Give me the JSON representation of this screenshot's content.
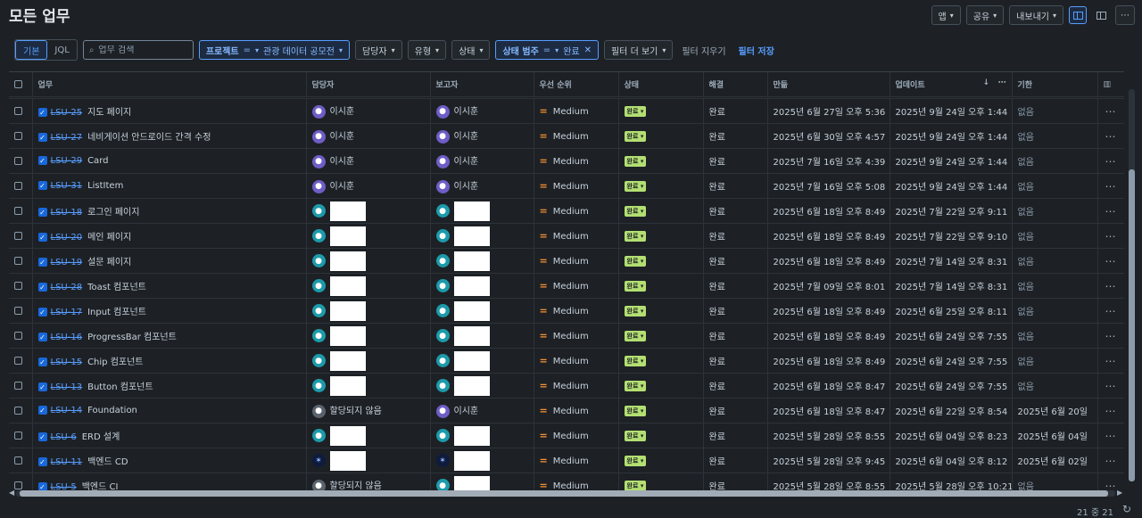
{
  "page": {
    "title": "모든 업무"
  },
  "toolbar": {
    "app": "앱",
    "share": "공유",
    "export": "내보내기",
    "more": "⋯"
  },
  "view_toggle": {
    "basic": "기본",
    "jql": "JQL"
  },
  "search": {
    "placeholder": "업무 검색",
    "value": ""
  },
  "filters": {
    "project_label": "프로젝트",
    "project_op": "=",
    "project_value": "관광 데이터 공모전",
    "assignee": "담당자",
    "type": "유형",
    "status": "상태",
    "category_label": "상태 범주",
    "category_op": "=",
    "category_value": "완료",
    "more_filters": "필터 더 보기",
    "clear": "필터 지우기",
    "save": "필터 저장"
  },
  "columns": [
    "업무",
    "담당자",
    "보고자",
    "우선 순위",
    "상태",
    "해결",
    "만듦",
    "업데이트",
    "기한"
  ],
  "rows": [
    {
      "key": "LSU-25",
      "summary": "지도 페이지",
      "assignee": "이시훈",
      "assignee_avatar": "purple",
      "reporter": "이시훈",
      "reporter_avatar": "purple",
      "priority": "Medium",
      "status": "완료",
      "resolution": "완료",
      "created": "2025년 6월 27일 오후 5:36",
      "updated": "2025년 9월 24일 오후 1:44",
      "due": "없음"
    },
    {
      "key": "LSU-27",
      "summary": "네비게이션 안드로이드 간격 수정",
      "assignee": "이시훈",
      "assignee_avatar": "purple",
      "reporter": "이시훈",
      "reporter_avatar": "purple",
      "priority": "Medium",
      "status": "완료",
      "resolution": "완료",
      "created": "2025년 6월 30일 오후 4:57",
      "updated": "2025년 9월 24일 오후 1:44",
      "due": "없음"
    },
    {
      "key": "LSU-29",
      "summary": "Card",
      "assignee": "이시훈",
      "assignee_avatar": "purple",
      "reporter": "이시훈",
      "reporter_avatar": "purple",
      "priority": "Medium",
      "status": "완료",
      "resolution": "완료",
      "created": "2025년 7월 16일 오후 4:39",
      "updated": "2025년 9월 24일 오후 1:44",
      "due": "없음"
    },
    {
      "key": "LSU-31",
      "summary": "ListItem",
      "assignee": "이시훈",
      "assignee_avatar": "purple",
      "reporter": "이시훈",
      "reporter_avatar": "purple",
      "priority": "Medium",
      "status": "완료",
      "resolution": "완료",
      "created": "2025년 7월 16일 오후 5:08",
      "updated": "2025년 9월 24일 오후 1:44",
      "due": "없음"
    },
    {
      "key": "LSU-18",
      "summary": "로그인 페이지",
      "assignee": "",
      "assignee_avatar": "cyan",
      "reporter": "",
      "reporter_avatar": "cyan",
      "priority": "Medium",
      "status": "완료",
      "resolution": "완료",
      "created": "2025년 6월 18일 오후 8:49",
      "updated": "2025년 7월 22일 오후 9:11",
      "due": "없음"
    },
    {
      "key": "LSU-20",
      "summary": "메인 페이지",
      "assignee": "",
      "assignee_avatar": "cyan",
      "reporter": "",
      "reporter_avatar": "cyan",
      "priority": "Medium",
      "status": "완료",
      "resolution": "완료",
      "created": "2025년 6월 18일 오후 8:49",
      "updated": "2025년 7월 22일 오후 9:10",
      "due": "없음"
    },
    {
      "key": "LSU-19",
      "summary": "설문 페이지",
      "assignee": "",
      "assignee_avatar": "cyan",
      "reporter": "",
      "reporter_avatar": "cyan",
      "priority": "Medium",
      "status": "완료",
      "resolution": "완료",
      "created": "2025년 6월 18일 오후 8:49",
      "updated": "2025년 7월 14일 오후 8:31",
      "due": "없음"
    },
    {
      "key": "LSU-28",
      "summary": "Toast 컴포넌트",
      "assignee": "",
      "assignee_avatar": "cyan",
      "reporter": "",
      "reporter_avatar": "cyan",
      "priority": "Medium",
      "status": "완료",
      "resolution": "완료",
      "created": "2025년 7월 09일 오후 8:01",
      "updated": "2025년 7월 14일 오후 8:31",
      "due": "없음"
    },
    {
      "key": "LSU-17",
      "summary": "Input 컴포넌트",
      "assignee": "",
      "assignee_avatar": "cyan",
      "reporter": "",
      "reporter_avatar": "cyan",
      "priority": "Medium",
      "status": "완료",
      "resolution": "완료",
      "created": "2025년 6월 18일 오후 8:49",
      "updated": "2025년 6월 25일 오후 8:11",
      "due": "없음"
    },
    {
      "key": "LSU-16",
      "summary": "ProgressBar 컴포넌트",
      "assignee": "",
      "assignee_avatar": "cyan",
      "reporter": "",
      "reporter_avatar": "cyan",
      "priority": "Medium",
      "status": "완료",
      "resolution": "완료",
      "created": "2025년 6월 18일 오후 8:49",
      "updated": "2025년 6월 24일 오후 7:55",
      "due": "없음"
    },
    {
      "key": "LSU-15",
      "summary": "Chip 컴포넌트",
      "assignee": "",
      "assignee_avatar": "cyan",
      "reporter": "",
      "reporter_avatar": "cyan",
      "priority": "Medium",
      "status": "완료",
      "resolution": "완료",
      "created": "2025년 6월 18일 오후 8:49",
      "updated": "2025년 6월 24일 오후 7:55",
      "due": "없음"
    },
    {
      "key": "LSU-13",
      "summary": "Button 컴포넌트",
      "assignee": "",
      "assignee_avatar": "cyan",
      "reporter": "",
      "reporter_avatar": "cyan",
      "priority": "Medium",
      "status": "완료",
      "resolution": "완료",
      "created": "2025년 6월 18일 오후 8:47",
      "updated": "2025년 6월 24일 오후 7:55",
      "due": "없음"
    },
    {
      "key": "LSU-14",
      "summary": "Foundation",
      "assignee": "할당되지 않음",
      "assignee_avatar": "gray",
      "reporter": "이시훈",
      "reporter_avatar": "purple",
      "priority": "Medium",
      "status": "완료",
      "resolution": "완료",
      "created": "2025년 6월 18일 오후 8:47",
      "updated": "2025년 6월 22일 오후 8:54",
      "due": "2025년 6월 20일"
    },
    {
      "key": "LSU-6",
      "summary": "ERD 설계",
      "assignee": "",
      "assignee_avatar": "cyan",
      "reporter": "",
      "reporter_avatar": "cyan",
      "priority": "Medium",
      "status": "완료",
      "resolution": "완료",
      "created": "2025년 5월 28일 오후 8:55",
      "updated": "2025년 6월 04일 오후 8:23",
      "due": "2025년 6월 04일"
    },
    {
      "key": "LSU-11",
      "summary": "백엔드 CD",
      "assignee": "",
      "assignee_avatar": "dark",
      "reporter": "",
      "reporter_avatar": "dark",
      "priority": "Medium",
      "status": "완료",
      "resolution": "완료",
      "created": "2025년 5월 28일 오후 9:45",
      "updated": "2025년 6월 04일 오후 8:12",
      "due": "2025년 6월 02일"
    },
    {
      "key": "LSU-5",
      "summary": "백엔드 CI",
      "assignee": "할당되지 않음",
      "assignee_avatar": "gray",
      "reporter": "",
      "reporter_avatar": "cyan",
      "priority": "Medium",
      "status": "완료",
      "resolution": "완료",
      "created": "2025년 5월 28일 오후 8:55",
      "updated": "2025년 5월 28일 오후 10:21",
      "due": "없음"
    }
  ],
  "footer": {
    "count": "21 중 21"
  }
}
